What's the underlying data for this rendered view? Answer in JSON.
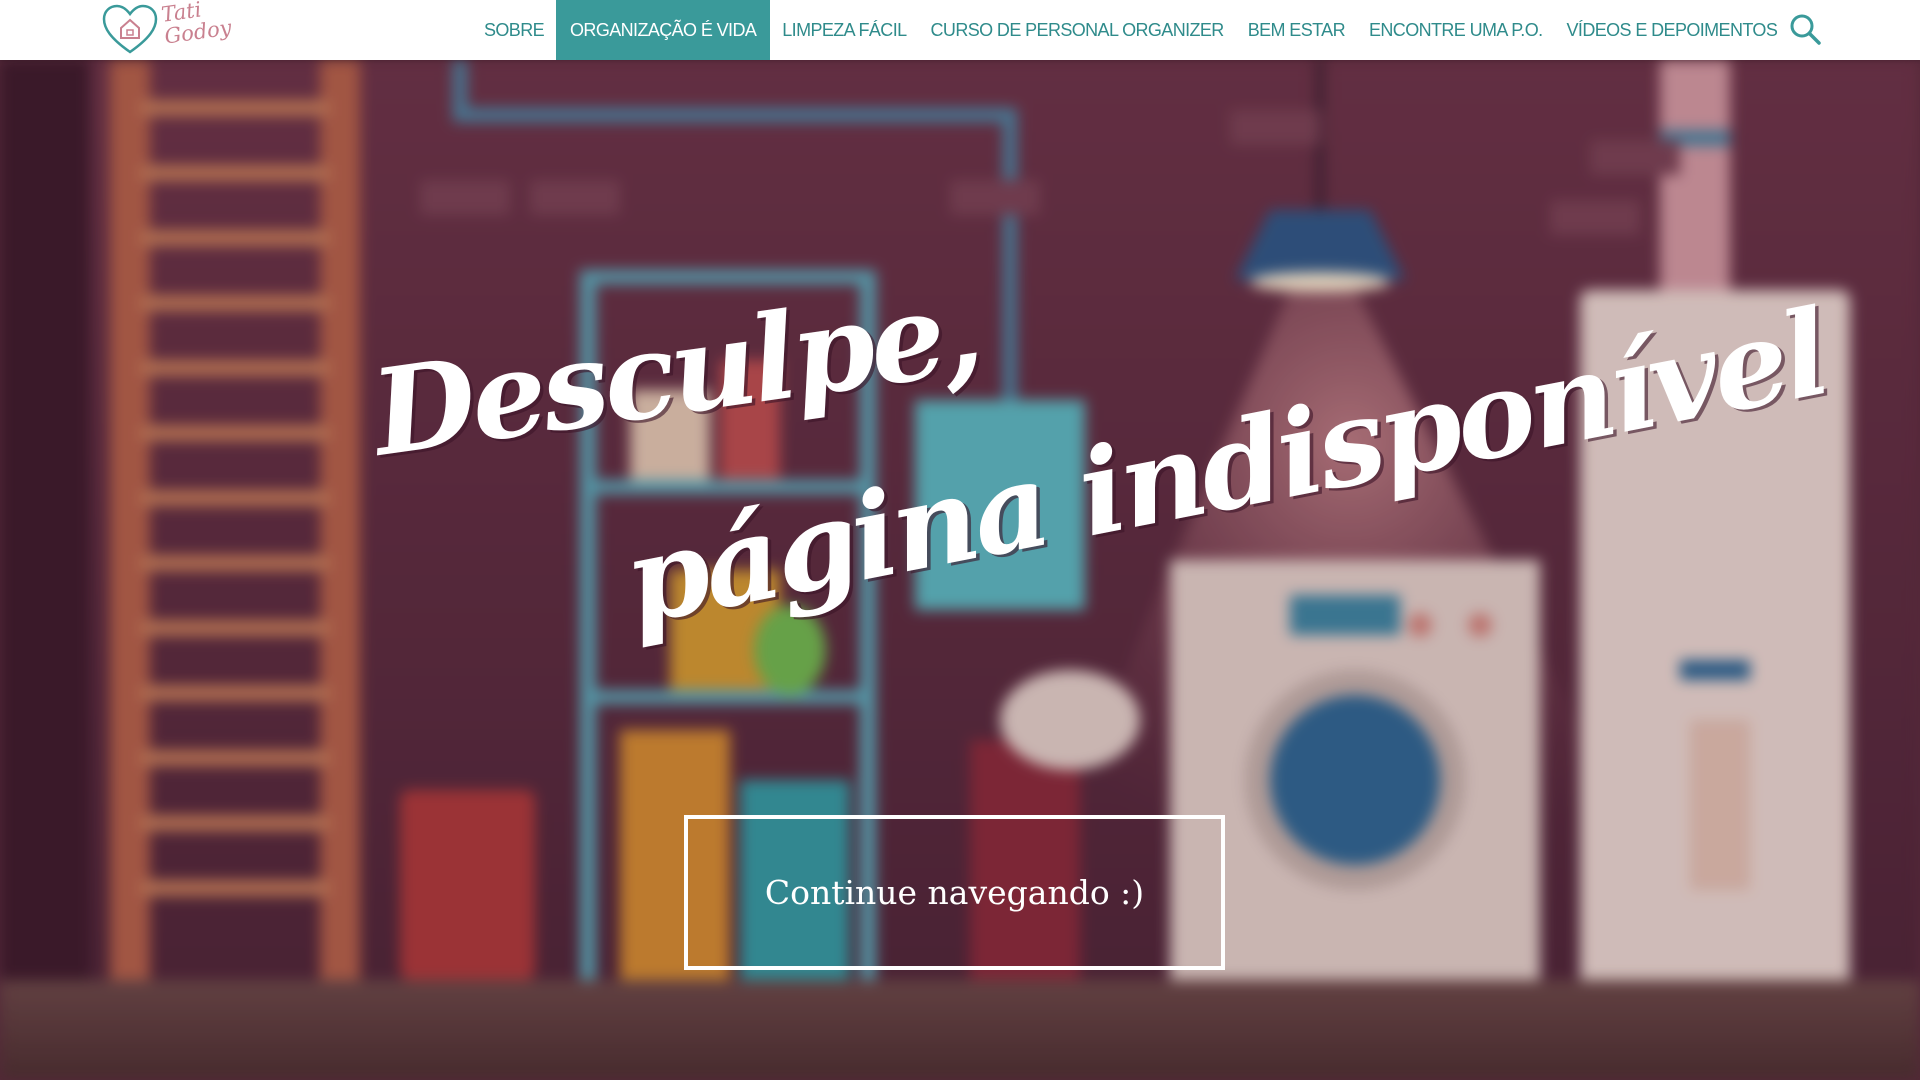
{
  "brand": {
    "logo_line1": "Tati",
    "logo_line2": "Godoy"
  },
  "nav": {
    "items": [
      {
        "label": "SOBRE",
        "active": false
      },
      {
        "label": "ORGANIZAÇÃO É VIDA",
        "active": true
      },
      {
        "label": "LIMPEZA FÁCIL",
        "active": false
      },
      {
        "label": "CURSO DE PERSONAL ORGANIZER",
        "active": false
      },
      {
        "label": "BEM ESTAR",
        "active": false
      },
      {
        "label": "ENCONTRE UMA P.O.",
        "active": false
      },
      {
        "label": "VÍDEOS E DEPOIMENTOS",
        "active": false
      }
    ],
    "search_icon": "search-icon"
  },
  "hero": {
    "headline_line1": "Desculpe,",
    "headline_line2": "página indisponível",
    "cta_label": "Continue navegando :)"
  },
  "colors": {
    "accent": "#3a9a9a",
    "nav_text": "#2f8b8b",
    "logo_pink": "#c9808f"
  }
}
